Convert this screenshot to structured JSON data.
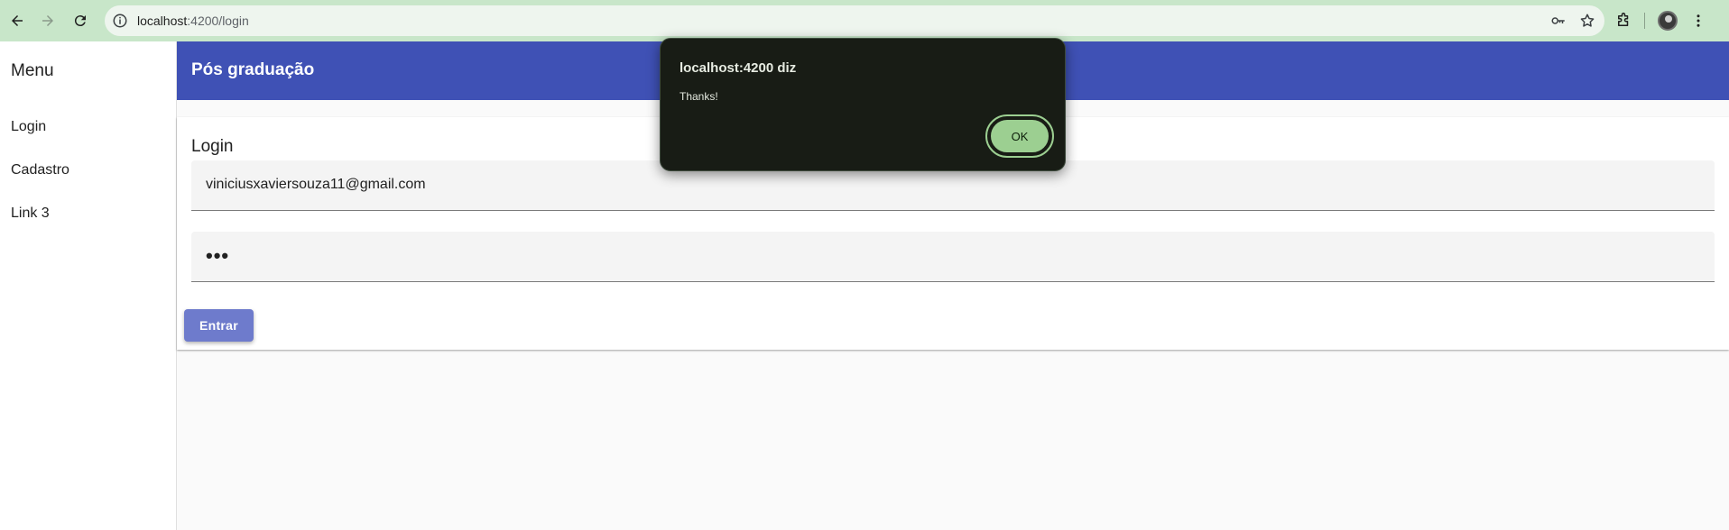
{
  "browser": {
    "url_host": "localhost",
    "url_path": ":4200/login",
    "icons": [
      "back-icon",
      "forward-icon",
      "reload-icon",
      "site-info-icon",
      "password-key-icon",
      "bookmark-star-icon",
      "extensions-icon",
      "profile-avatar",
      "more-menu-icon"
    ]
  },
  "sidebar": {
    "title": "Menu",
    "items": [
      {
        "label": "Login"
      },
      {
        "label": "Cadastro"
      },
      {
        "label": "Link 3"
      }
    ]
  },
  "header": {
    "title": "Pós graduação",
    "color": "#3f51b5"
  },
  "login_card": {
    "title": "Login",
    "email_value": "viniciusxaviersouza11@gmail.com",
    "password_value": "•••",
    "submit_label": "Entrar"
  },
  "alert": {
    "title": "localhost:4200 diz",
    "message": "Thanks!",
    "ok_label": "OK"
  }
}
